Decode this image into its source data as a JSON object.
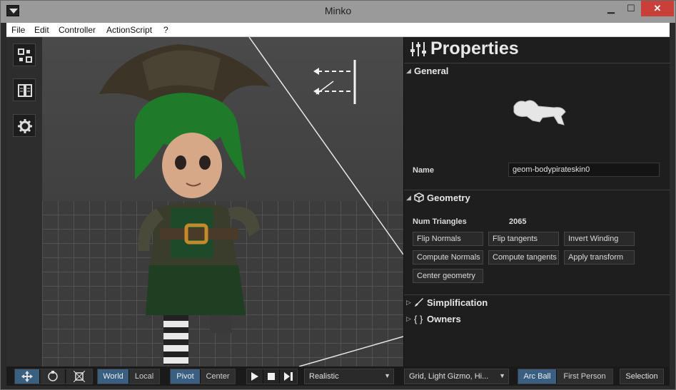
{
  "window": {
    "title": "Minko",
    "minimize": "▁",
    "maximize": "☐",
    "close": "✕"
  },
  "menu": {
    "items": [
      "File",
      "Edit",
      "Controller",
      "ActionScript",
      "?"
    ]
  },
  "toolstrip": {
    "icons": [
      "scene-graph-icon",
      "library-icon",
      "settings-gear-icon"
    ]
  },
  "properties": {
    "title": "Properties",
    "general": {
      "label": "General",
      "name_label": "Name",
      "name_value": "geom-bodypirateskin0"
    },
    "geometry": {
      "label": "Geometry",
      "num_triangles_label": "Num Triangles",
      "num_triangles_value": "2065",
      "buttons": [
        "Flip Normals",
        "Flip tangents",
        "Invert Winding",
        "Compute Normals",
        "Compute tangents",
        "Apply transform",
        "Center geometry"
      ]
    },
    "simplification": {
      "label": "Simplification"
    },
    "owners": {
      "label": "Owners"
    }
  },
  "bottombar": {
    "space": [
      "World",
      "Local"
    ],
    "space_selected": "World",
    "anchor": [
      "Pivot",
      "Center"
    ],
    "anchor_selected": "Pivot",
    "render_mode": "Realistic",
    "overlays": "Grid, Light Gizmo, Hi...",
    "camera": [
      "Arc Ball",
      "First Person"
    ],
    "camera_selected": "Arc Ball",
    "selection": "Selection"
  },
  "colors": {
    "accent": "#3b5f80",
    "close": "#c9403a",
    "panel": "#1e1e1e"
  }
}
